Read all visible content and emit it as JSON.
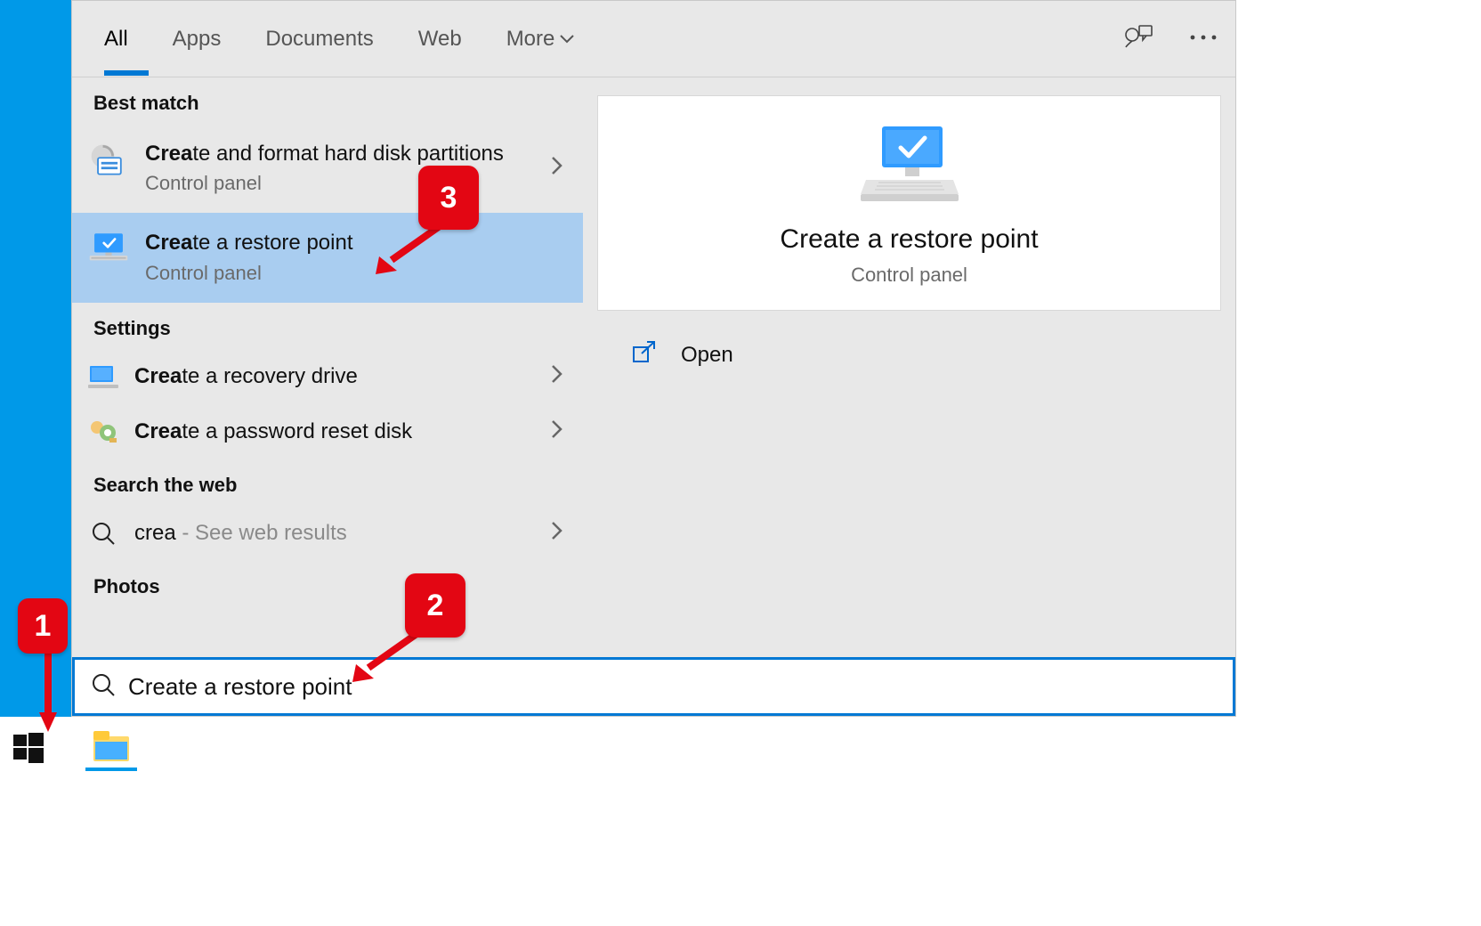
{
  "tabs": {
    "all": "All",
    "apps": "Apps",
    "documents": "Documents",
    "web": "Web",
    "more": "More"
  },
  "sections": {
    "best_match": "Best match",
    "settings": "Settings",
    "search_web": "Search the web",
    "photos": "Photos"
  },
  "results": {
    "bm1": {
      "b": "Crea",
      "rest": "te and format hard disk partitions",
      "sub": "Control panel"
    },
    "bm2": {
      "b": "Crea",
      "rest": "te a restore point",
      "sub": "Control panel"
    },
    "s1": {
      "b": "Crea",
      "rest": "te a recovery drive"
    },
    "s2": {
      "b": "Crea",
      "rest": "te a password reset disk"
    },
    "w1": {
      "term": "crea",
      "hint": " - See web results"
    }
  },
  "preview": {
    "title": "Create a restore point",
    "sub": "Control panel"
  },
  "actions": {
    "open": "Open"
  },
  "search": {
    "value": "Create a restore point"
  },
  "annotations": {
    "b1": "1",
    "b2": "2",
    "b3": "3"
  }
}
